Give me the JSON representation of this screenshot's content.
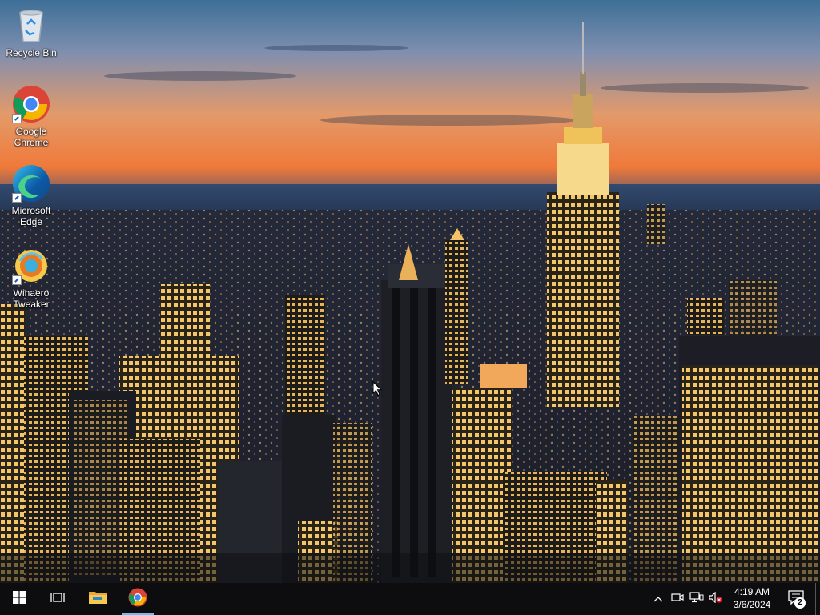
{
  "desktop": {
    "icons": [
      {
        "label": "Recycle Bin",
        "icon": "recycle-bin-icon"
      },
      {
        "label": "Google Chrome",
        "icon": "chrome-icon"
      },
      {
        "label": "Microsoft Edge",
        "icon": "edge-icon"
      },
      {
        "label": "Winaero Tweaker",
        "icon": "winaero-tweaker-icon"
      }
    ],
    "wallpaper": "city-skyline-sunset"
  },
  "taskbar": {
    "start": {
      "icon": "windows-logo-icon"
    },
    "task_view": {
      "icon": "task-view-icon"
    },
    "pinned": [
      {
        "name": "File Explorer",
        "icon": "folder-icon",
        "active": false
      },
      {
        "name": "Google Chrome",
        "icon": "chrome-icon",
        "active": true
      }
    ],
    "tray": {
      "icons": [
        "chevron-up-icon",
        "meet-now-icon",
        "network-icon",
        "volume-muted-icon"
      ],
      "time": "4:19 AM",
      "date": "3/6/2024",
      "notification_count": "2"
    }
  },
  "colors": {
    "taskbar_bg": "#0d0d0f",
    "active_indicator": "#76b9ed",
    "sky_top": "#3a6f98",
    "sky_horizon": "#f08a3c"
  }
}
